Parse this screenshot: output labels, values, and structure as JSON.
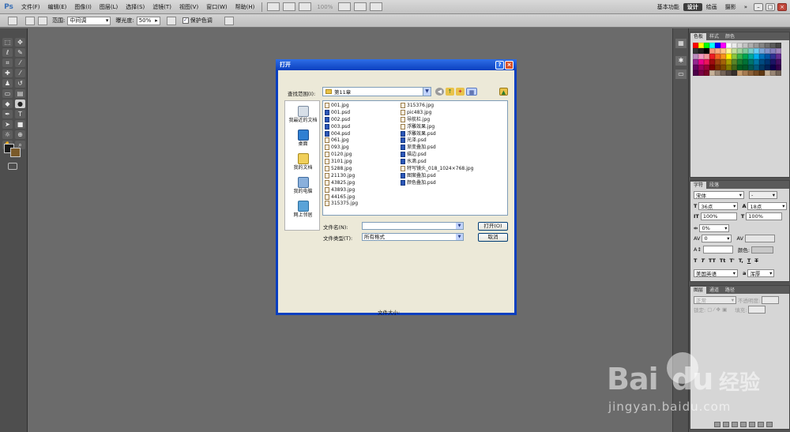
{
  "menu": {
    "logo": "Ps",
    "items": [
      "文件(F)",
      "编辑(E)",
      "图像(I)",
      "图层(L)",
      "选择(S)",
      "滤镜(T)",
      "视图(V)",
      "窗口(W)",
      "帮助(H)"
    ],
    "zoom": "100%",
    "workspaces": [
      "基本功能",
      "设计",
      "绘画",
      "摄影"
    ],
    "active_workspace": "设计",
    "more": "»"
  },
  "options": {
    "range_label": "范围:",
    "range_value": "中间调",
    "exposure_label": "曝光度:",
    "exposure_value": "50%",
    "protect_label": "保护色调",
    "protect_checked": true
  },
  "dialog": {
    "title": "打开",
    "help_btn": "?",
    "close_btn": "×",
    "lookin_label": "查找范围(I):",
    "lookin_value": "第11章",
    "places": [
      "我最近的文档",
      "桌面",
      "我的文档",
      "我的电脑",
      "网上邻居"
    ],
    "files_col1": [
      {
        "name": "001.jpg",
        "type": "jpg"
      },
      {
        "name": "001.psd",
        "type": "psd"
      },
      {
        "name": "002.psd",
        "type": "psd"
      },
      {
        "name": "003.psd",
        "type": "psd"
      },
      {
        "name": "004.psd",
        "type": "psd"
      },
      {
        "name": "061.jpg",
        "type": "jpg"
      },
      {
        "name": "093.jpg",
        "type": "jpg"
      },
      {
        "name": "0120.jpg",
        "type": "jpg"
      },
      {
        "name": "3101.jpg",
        "type": "jpg"
      },
      {
        "name": "5288.jpg",
        "type": "jpg"
      },
      {
        "name": "21130.jpg",
        "type": "jpg"
      },
      {
        "name": "43825.jpg",
        "type": "jpg"
      },
      {
        "name": "43893.jpg",
        "type": "jpg"
      },
      {
        "name": "44165.jpg",
        "type": "jpg"
      },
      {
        "name": "315375.jpg",
        "type": "jpg"
      }
    ],
    "files_col2": [
      {
        "name": "315376.jpg",
        "type": "jpg"
      },
      {
        "name": "pic483.jpg",
        "type": "jpg"
      },
      {
        "name": "导航栏.jpg",
        "type": "jpg"
      },
      {
        "name": "浮雕效果.jpg",
        "type": "jpg"
      },
      {
        "name": "浮雕效果.psd",
        "type": "psd"
      },
      {
        "name": "光泽.psd",
        "type": "psd"
      },
      {
        "name": "渐变叠加.psd",
        "type": "psd"
      },
      {
        "name": "描边.psd",
        "type": "psd"
      },
      {
        "name": "水滴.psd",
        "type": "psd"
      },
      {
        "name": "特写镜头_018_1024×768.jpg",
        "type": "jpg"
      },
      {
        "name": "图案叠加.psd",
        "type": "psd"
      },
      {
        "name": "颜色叠加.psd",
        "type": "psd"
      }
    ],
    "filename_label": "文件名(N):",
    "filename_value": "",
    "filetype_label": "文件类型(T):",
    "filetype_value": "所有格式",
    "open_btn": "打开(O)",
    "cancel_btn": "取消",
    "filesize_label": "文件大小:"
  },
  "panels": {
    "swatch_tabs": [
      "色板",
      "样式",
      "颜色"
    ],
    "char_tabs": [
      "字符",
      "段落"
    ],
    "font": "宋体",
    "font_style": "-",
    "size": "36点",
    "leading": "18点",
    "vscale": "100%",
    "hscale": "100%",
    "tracking": "0%",
    "kerning": "0",
    "color_label": "颜色:",
    "language": "美国英语",
    "aa_label": "a",
    "aa_value": "浑厚",
    "layer_tabs": [
      "图层",
      "通道",
      "路径"
    ],
    "blend": "正常",
    "opacity_label": "不透明度:",
    "lock_label": "锁定:",
    "fill_label": "填充:"
  },
  "watermark": {
    "brand": "Bai",
    "brand2": "du",
    "cn": "经验",
    "url": "jingyan.baidu.com"
  },
  "colors": {
    "dialog_title": "#0a3fbf",
    "workspace_bg": "#6b6b6b",
    "foreground": "#1a1a1a",
    "background": "#7a5a2a"
  }
}
